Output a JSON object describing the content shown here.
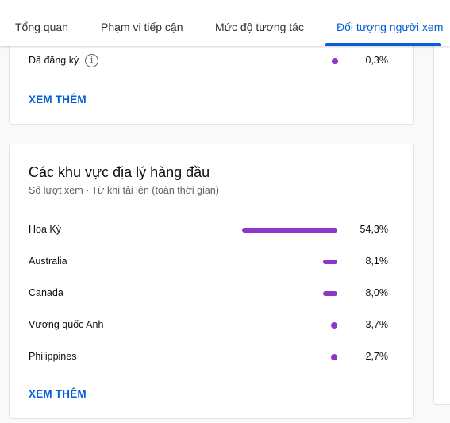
{
  "tabs": [
    {
      "label": "Tổng quan"
    },
    {
      "label": "Phạm vi tiếp cận"
    },
    {
      "label": "Mức độ tương tác"
    },
    {
      "label": "Đối tượng người xem"
    }
  ],
  "active_tab": "Đối tượng người xem",
  "subscription_card": {
    "row_label": "Đã đăng ký",
    "row_value": "0,3%",
    "info_icon": "info-icon",
    "see_more": "XEM THÊM"
  },
  "geo_card": {
    "title": "Các khu vực địa lý hàng đầu",
    "subtitle": "Số lượt xem · Từ khi tải lên (toàn thời gian)",
    "rows": [
      {
        "label": "Hoa Kỳ",
        "value": "54,3%",
        "share": 54.3
      },
      {
        "label": "Australia",
        "value": "8,1%",
        "share": 8.1
      },
      {
        "label": "Canada",
        "value": "8,0%",
        "share": 8.0
      },
      {
        "label": "Vương quốc Anh",
        "value": "3,7%",
        "share": 3.7
      },
      {
        "label": "Philippines",
        "value": "2,7%",
        "share": 2.7
      }
    ],
    "see_more": "XEM THÊM"
  },
  "colors": {
    "accent": "#065fd4",
    "bar": "#8e35cb"
  }
}
